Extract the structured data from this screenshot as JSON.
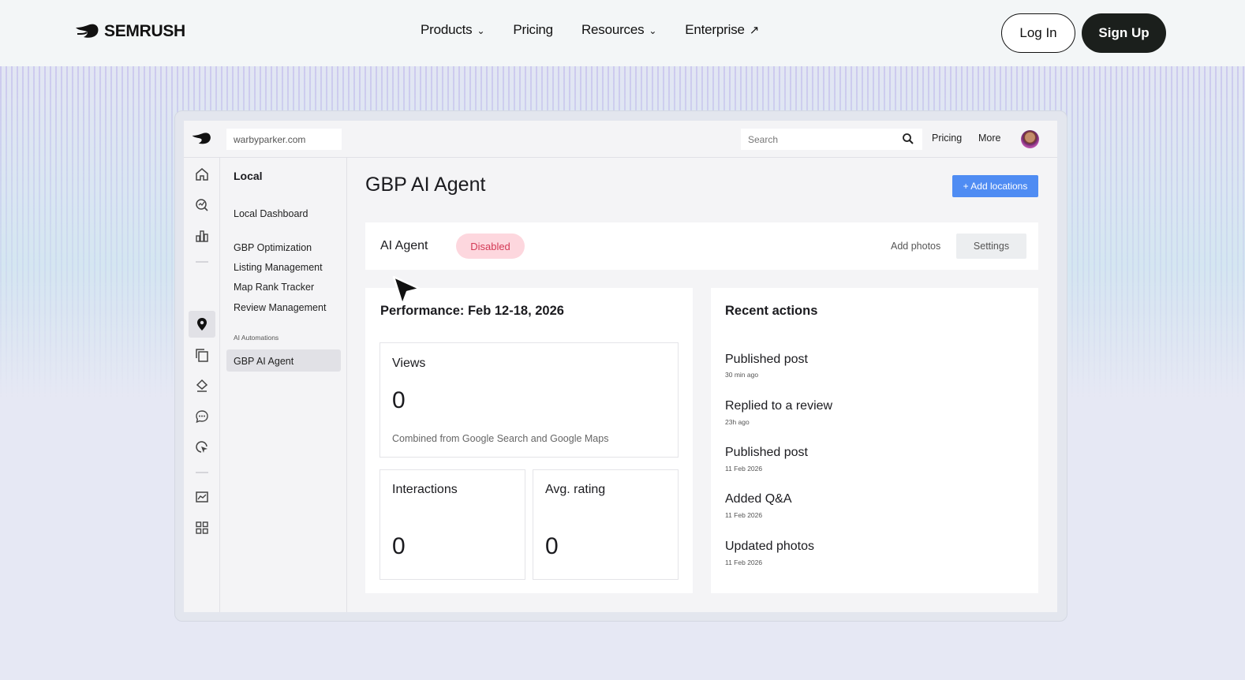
{
  "site": {
    "brand": "SEMRUSH",
    "nav": [
      {
        "label": "Products",
        "has_dropdown": true
      },
      {
        "label": "Pricing",
        "has_dropdown": false
      },
      {
        "label": "Resources",
        "has_dropdown": true
      },
      {
        "label": "Enterprise",
        "external": true
      }
    ],
    "login_label": "Log In",
    "signup_label": "Sign Up"
  },
  "app": {
    "domain_value": "warbyparker.com",
    "search_placeholder": "Search",
    "top_links": [
      "Pricing",
      "More"
    ],
    "rail_icons": [
      "home-icon",
      "search-chart-icon",
      "bar-chart-icon",
      "location-pin-icon",
      "copy-icon",
      "layers-icon",
      "chat-icon",
      "cursor-click-icon",
      "trend-chart-icon",
      "grid-icon"
    ],
    "sidebar": {
      "title": "Local",
      "items": [
        "Local Dashboard",
        "GBP Optimization",
        "Listing Management",
        "Map Rank Tracker",
        "Review Management"
      ],
      "caption": "AI Automations",
      "active_item": "GBP AI Agent"
    },
    "main": {
      "title": "GBP AI Agent",
      "add_button": "+ Add locations",
      "agent": {
        "label": "AI Agent",
        "status": "Disabled",
        "add_photos": "Add photos",
        "settings": "Settings"
      },
      "performance": {
        "title": "Performance: Feb 12-18, 2026",
        "views": {
          "label": "Views",
          "value": "0",
          "note": "Combined from Google Search and Google Maps"
        },
        "interactions": {
          "label": "Interactions",
          "value": "0"
        },
        "rating": {
          "label": "Avg. rating",
          "value": "0"
        }
      },
      "recent": {
        "title": "Recent actions",
        "items": [
          {
            "title": "Published post",
            "time": "30 min ago"
          },
          {
            "title": "Replied to a review",
            "time": "23h ago"
          },
          {
            "title": "Published post",
            "time": "11 Feb 2026"
          },
          {
            "title": "Added Q&A",
            "time": "11 Feb 2026"
          },
          {
            "title": "Updated photos",
            "time": "11 Feb 2026"
          }
        ]
      }
    }
  },
  "colors": {
    "accent_blue": "#4f8cf3",
    "disabled_bg": "#fdd7de",
    "disabled_text": "#d43a56",
    "dark": "#1b1f1c"
  }
}
